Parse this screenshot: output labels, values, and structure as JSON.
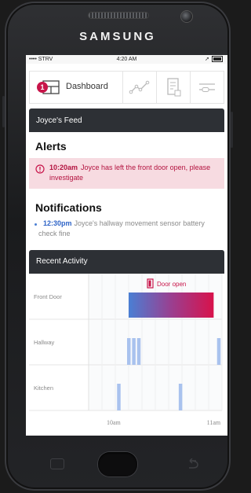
{
  "device": {
    "brand": "SAMSUNG"
  },
  "status_bar": {
    "carrier": "•••• STRV",
    "time": "4:20 AM"
  },
  "nav": {
    "dashboard_label": "Dashboard",
    "badge_count": "1",
    "items": [
      {
        "icon": "chart-line-icon"
      },
      {
        "icon": "document-list-icon"
      },
      {
        "icon": "settings-slider-icon"
      }
    ]
  },
  "feed": {
    "title": "Joyce's Feed",
    "alerts_title": "Alerts",
    "alerts": [
      {
        "time": "10:20am",
        "text": "Joyce has left the front door open, please investigate"
      }
    ],
    "notifications_title": "Notifications",
    "notifications": [
      {
        "time": "12:30pm",
        "text": "Joyce's hallway movement sensor battery check fine"
      }
    ]
  },
  "recent_activity": {
    "title": "Recent Activity",
    "legend": "Door open",
    "rows": [
      "Front Door",
      "Hallway",
      "Kitchen"
    ],
    "x_ticks": [
      "10am",
      "11am"
    ]
  },
  "colors": {
    "accent_red": "#c8154a",
    "accent_blue": "#4a7fd4",
    "alert_bg": "#f7dbe1",
    "header_dark": "#2d3035",
    "activity_bar": "#a9c2ee"
  },
  "chart_data": {
    "type": "timeline",
    "x_range": [
      "9:45am",
      "11:05am"
    ],
    "x_ticks": [
      "10am",
      "11am"
    ],
    "categories": [
      "Front Door",
      "Hallway",
      "Kitchen"
    ],
    "series": [
      {
        "name": "Door open",
        "category": "Front Door",
        "intervals": [
          [
            "10:09am",
            "11:00am"
          ]
        ]
      },
      {
        "category": "Hallway",
        "events": [
          "10:09am",
          "10:12am",
          "10:15am",
          "11:03am"
        ]
      },
      {
        "category": "Kitchen",
        "events": [
          "10:03am",
          "10:40am"
        ]
      }
    ]
  }
}
